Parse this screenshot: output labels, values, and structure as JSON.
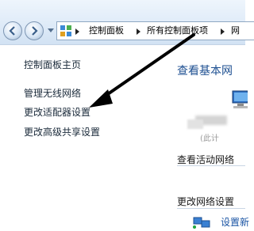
{
  "address_bar": {
    "breadcrumbs": [
      "控制面板",
      "所有控制面板项",
      "网"
    ]
  },
  "sidebar": {
    "items": [
      {
        "label": "控制面板主页"
      },
      {
        "label": "管理无线网络"
      },
      {
        "label": "更改适配器设置"
      },
      {
        "label": "更改高级共享设置"
      }
    ]
  },
  "main": {
    "title": "查看基本网",
    "blurred_text": "(此计",
    "section_active": "查看活动网络",
    "section_change": "更改网络设置",
    "setup_link": "设置新"
  },
  "icons": [
    "back-icon",
    "forward-icon",
    "control-panel-icon",
    "computer-icon",
    "network-setup-icon"
  ],
  "colors": {
    "arrow": "#000000",
    "link": "#1b55a4",
    "title": "#1d4f91"
  }
}
